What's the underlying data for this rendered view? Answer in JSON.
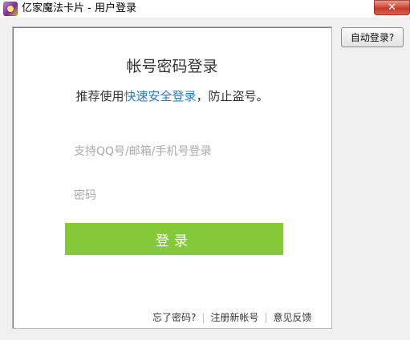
{
  "window": {
    "title": "亿家魔法卡片 - 用户登录",
    "close_label": "✕"
  },
  "login": {
    "title": "帐号密码登录",
    "recommend_prefix": "推荐使用",
    "recommend_link": "快速安全登录",
    "recommend_suffix": "，防止盗号。",
    "account_placeholder": "支持QQ号/邮箱/手机号登录",
    "password_placeholder": "密码",
    "account_value": "",
    "password_value": "",
    "login_button": "登录"
  },
  "footer": {
    "forgot_password": "忘了密码?",
    "separator": "|",
    "register": "注册新帐号",
    "feedback": "意见反馈"
  },
  "side": {
    "auto_login_button": "自动登录?"
  },
  "colors": {
    "login_button_bg": "#85c93b",
    "link": "#2b78c2",
    "close_button": "#c43c2b"
  },
  "icons": {
    "app": "magic-card-app-icon",
    "close": "close-icon"
  }
}
